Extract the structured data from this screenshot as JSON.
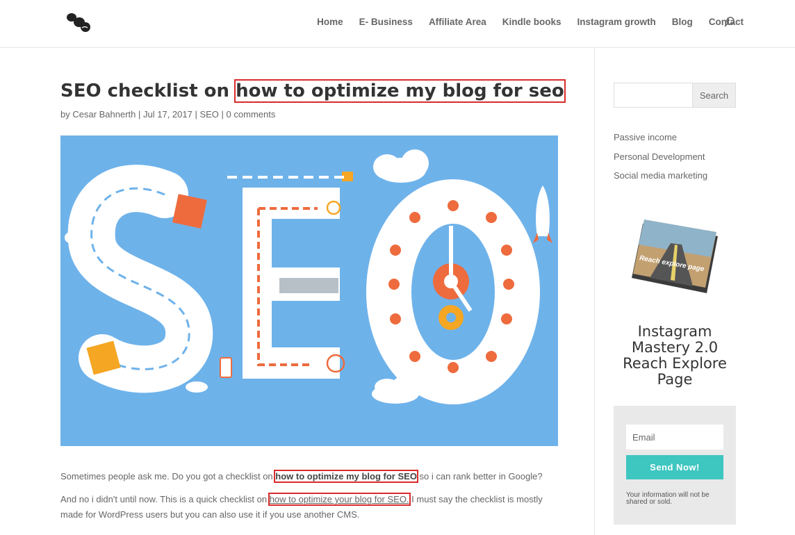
{
  "nav": {
    "items": [
      "Home",
      "E- Business",
      "Affiliate Area",
      "Kindle books",
      "Instagram growth",
      "Blog",
      "Contact"
    ]
  },
  "post": {
    "title_plain": "SEO checklist on ",
    "title_highlight": "how to optimize my blog for seo",
    "meta": {
      "by": "by ",
      "author": "Cesar Bahnerth",
      "sep1": " | ",
      "date": "Jul 17, 2017",
      "sep2": " | ",
      "category": "SEO",
      "sep3": " | ",
      "comments": "0 comments"
    },
    "p1": {
      "before": "Sometimes people ask me. Do you got a checklist on ",
      "highlight": "how to optimize my blog for SEO",
      "after": " so i can rank better in Google?"
    },
    "p2": {
      "before": "And no i didn't until now. This is a quick checklist on ",
      "link": "how to optimize your blog for SEO.",
      "after": " I must say the checklist is mostly made for WordPress users but you can also use it if you use another CMS."
    },
    "image_text": "SEO"
  },
  "sidebar": {
    "search_button": "Search",
    "categories": [
      "Passive income",
      "Personal Development",
      "Social media marketing"
    ],
    "book_cover_text": "Reach explore page",
    "promo_title": "Instagram Mastery 2.0 Reach Explore Page",
    "email_placeholder": "Email",
    "send_button": "Send Now!",
    "note": "Your information will not be shared or sold."
  },
  "colors": {
    "accent_teal": "#3ec6c0",
    "highlight_red": "#d92b2b",
    "image_bg": "#6eb2ea"
  }
}
